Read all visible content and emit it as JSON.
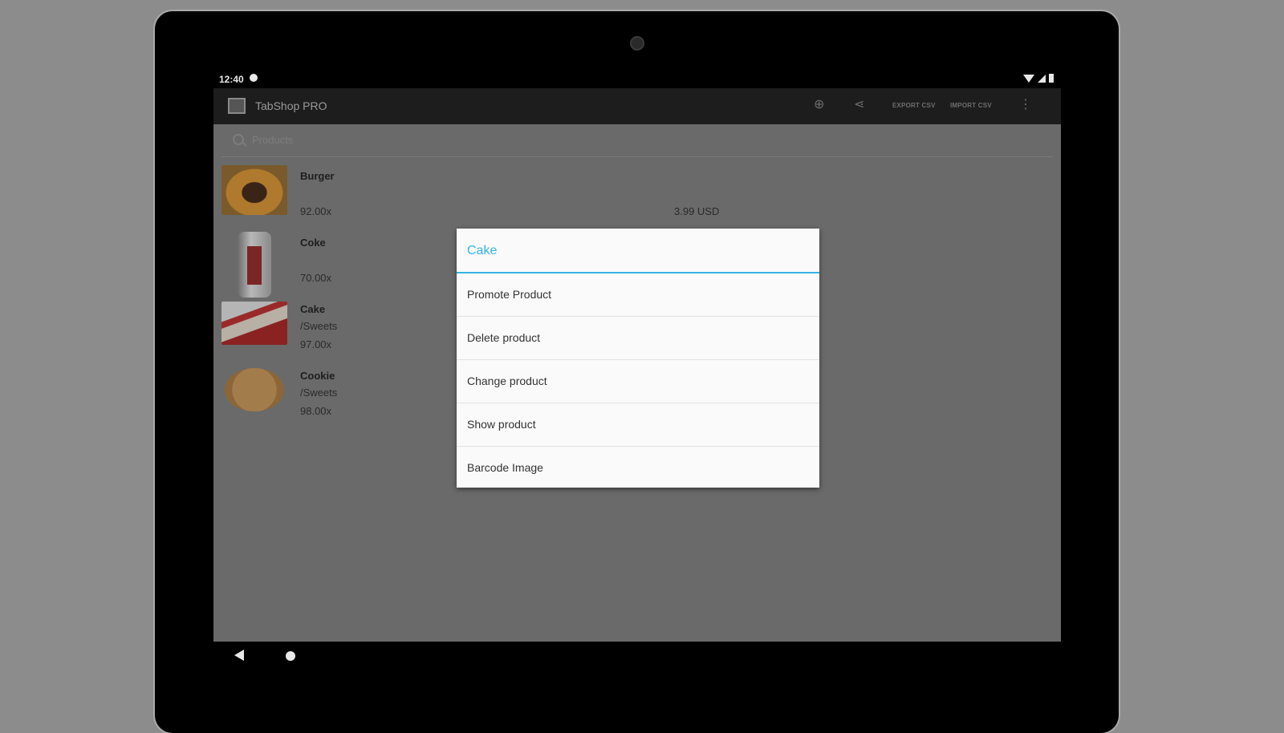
{
  "status_bar": {
    "time": "12:40"
  },
  "action_bar": {
    "title": "TabShop PRO",
    "export_label": "EXPORT CSV",
    "import_label": "IMPORT CSV",
    "add_icon": "add-circle-icon",
    "share_icon": "share-icon",
    "overflow_icon": "more-vert-icon"
  },
  "search": {
    "placeholder": "Products"
  },
  "products": [
    {
      "name": "Burger",
      "category": "",
      "quantity": "92.00x",
      "price": "3.99 USD",
      "image": "burger"
    },
    {
      "name": "Coke",
      "category": "",
      "quantity": "70.00x",
      "price": "",
      "image": "coke"
    },
    {
      "name": "Cake",
      "category": "/Sweets",
      "quantity": "97.00x",
      "price": "",
      "image": "cake"
    },
    {
      "name": "Cookie",
      "category": "/Sweets",
      "quantity": "98.00x",
      "price": "",
      "image": "cookie"
    }
  ],
  "dialog": {
    "title": "Cake",
    "items": [
      "Promote Product",
      "Delete product",
      "Change product",
      "Show product",
      "Barcode Image"
    ]
  },
  "colors": {
    "accent": "#33b5e5",
    "actionbar": "#1d1d1d",
    "dim_overlay": "#6a6a6a"
  }
}
